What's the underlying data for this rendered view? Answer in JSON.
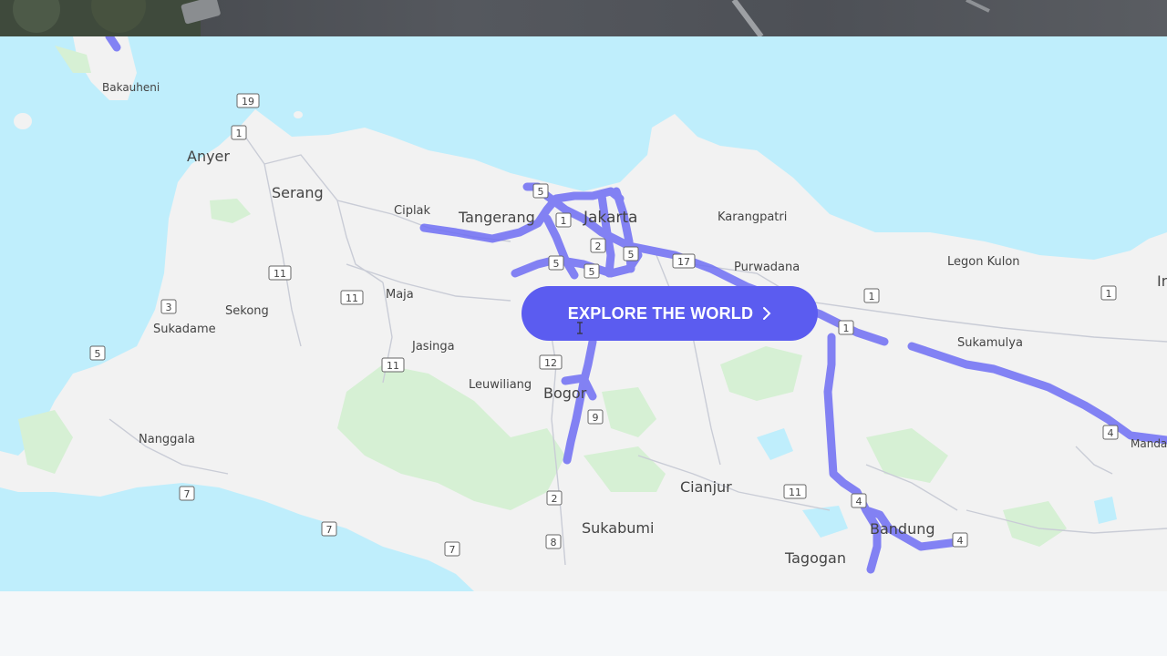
{
  "button": {
    "label": "EXPLORE THE WORLD",
    "color": "#5b5cf0",
    "icon": "chevron-right-icon"
  },
  "map": {
    "colors": {
      "water": "#bfeefc",
      "land": "#f2f2f2",
      "forest": "#d6f0d4",
      "route": "#6f6ef4",
      "road": "#c9ccd6"
    },
    "cities": [
      {
        "name": "Bakauheni"
      },
      {
        "name": "Anyer"
      },
      {
        "name": "Serang"
      },
      {
        "name": "Ciplak"
      },
      {
        "name": "Tangerang"
      },
      {
        "name": "Jakarta"
      },
      {
        "name": "Karangpatri"
      },
      {
        "name": "Purwadana"
      },
      {
        "name": "Legon Kulon"
      },
      {
        "name": "Sekong"
      },
      {
        "name": "Sukadame"
      },
      {
        "name": "Maja"
      },
      {
        "name": "Jasinga"
      },
      {
        "name": "Leuwiliang"
      },
      {
        "name": "Bogor"
      },
      {
        "name": "Sukamulya"
      },
      {
        "name": "Nanggala"
      },
      {
        "name": "Cianjur"
      },
      {
        "name": "Sukabumi"
      },
      {
        "name": "Bandung"
      },
      {
        "name": "Tagogan"
      },
      {
        "name": "Manda"
      },
      {
        "name": "In"
      }
    ],
    "shields": [
      "19",
      "1",
      "11",
      "3",
      "11",
      "5",
      "11",
      "12",
      "9",
      "2",
      "7",
      "7",
      "7",
      "8",
      "11",
      "4",
      "4",
      "1",
      "1",
      "1",
      "4",
      "17",
      "5",
      "1",
      "2",
      "5",
      "5",
      "5"
    ]
  }
}
